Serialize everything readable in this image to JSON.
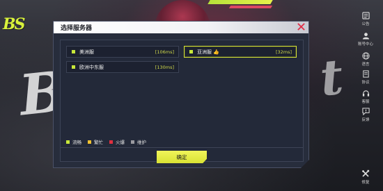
{
  "background": {
    "logo_text": "BS"
  },
  "dialog": {
    "title": "选择服务器",
    "confirm_label": "确定"
  },
  "servers": [
    {
      "name": "美洲服",
      "ping": "[106ms]",
      "status_color": "#c8e83a",
      "selected": false
    },
    {
      "name": "亚洲服",
      "ping": "[32ms]",
      "status_color": "#c8e83a",
      "selected": true,
      "recommended_icon": "thumbs-up-icon"
    },
    {
      "name": "欧洲中东服",
      "ping": "[130ms]",
      "status_color": "#c8e83a",
      "selected": false
    }
  ],
  "legend": [
    {
      "label": "流畅",
      "color": "#c8e83a"
    },
    {
      "label": "繁忙",
      "color": "#f2c230"
    },
    {
      "label": "火爆",
      "color": "#e03040"
    },
    {
      "label": "维护",
      "color": "#9a9aa0"
    }
  ],
  "side_menu": [
    {
      "label": "公告",
      "icon": "announcement-icon"
    },
    {
      "label": "账号中心",
      "icon": "user-icon"
    },
    {
      "label": "语言",
      "icon": "globe-icon"
    },
    {
      "label": "协议",
      "icon": "document-icon"
    },
    {
      "label": "客服",
      "icon": "headset-icon"
    },
    {
      "label": "反馈",
      "icon": "feedback-icon"
    },
    {
      "label": "修复",
      "icon": "tools-icon"
    }
  ],
  "colors": {
    "accent": "#d9e234",
    "dialog_bg": "#272d3c",
    "close_icon": "#e0304a"
  }
}
